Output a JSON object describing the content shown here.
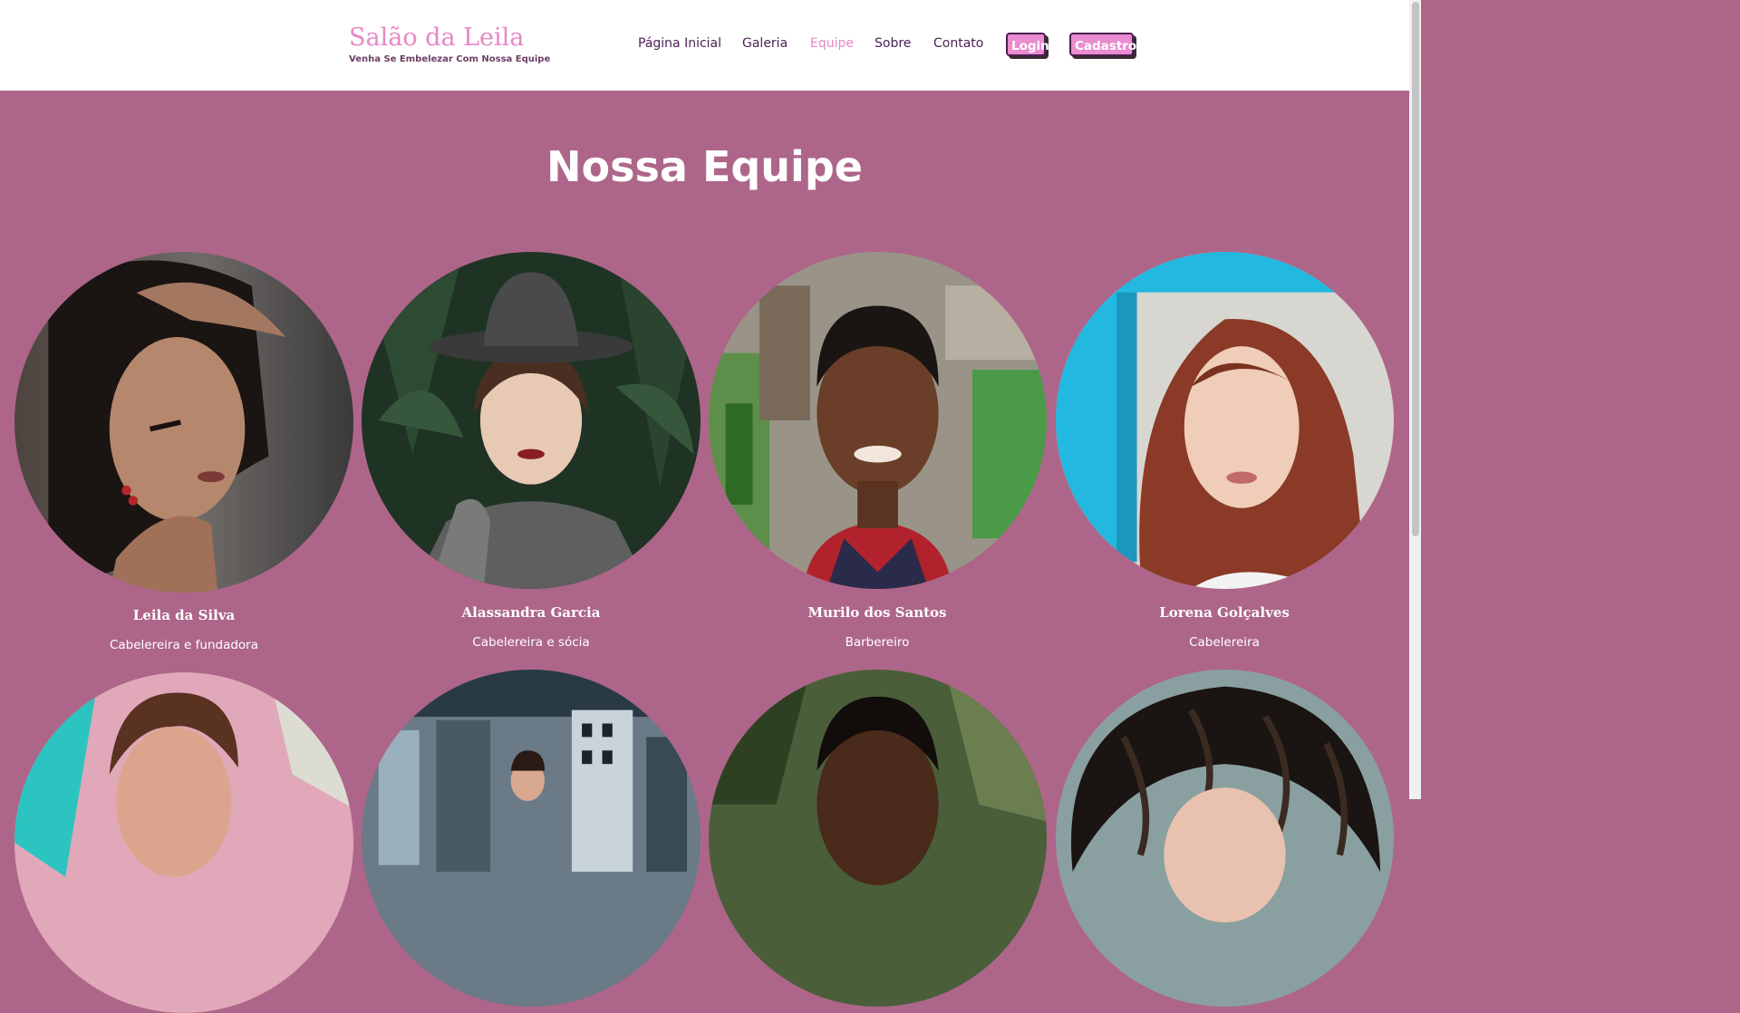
{
  "header": {
    "site_title": "Salão da Leila",
    "tagline": "Venha Se Embelezar Com Nossa Equipe",
    "nav": {
      "home": "Página Inicial",
      "gallery": "Galeria",
      "team": "Equipe",
      "about": "Sobre",
      "contact": "Contato"
    },
    "login_label": "Login",
    "signup_label": "Cadastro"
  },
  "main": {
    "title": "Nossa Equipe",
    "team": [
      {
        "name": "Leila da Silva",
        "role": "Cabelereira e fundadora"
      },
      {
        "name": "Alassandra Garcia",
        "role": "Cabelereira e sócia"
      },
      {
        "name": "Murilo dos Santos",
        "role": "Barbereiro"
      },
      {
        "name": "Lorena Golçalves",
        "role": "Cabelereira"
      }
    ]
  },
  "colors": {
    "page_background": "#ad6689",
    "accent_pink": "#e887c4",
    "nav_text": "#4a1f52"
  }
}
